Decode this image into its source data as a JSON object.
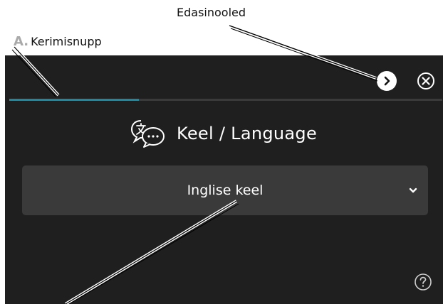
{
  "callouts": {
    "advanced_label": "Edasinooled",
    "a_letter": "A.",
    "a_label": "Kerimisnupp"
  },
  "screen": {
    "progress_fraction": 0.3,
    "heading": "Keel /  Language",
    "dropdown": {
      "selected_value": "Inglise keel"
    },
    "icons": {
      "next": "chevron-right-icon",
      "close": "close-icon",
      "language": "language-icon",
      "dropdown": "chevron-down-icon",
      "help": "help-icon"
    },
    "colors": {
      "background": "#1f1f1f",
      "progress": "#1a8aa0",
      "dropdown_bg": "#3a3a3a"
    }
  }
}
